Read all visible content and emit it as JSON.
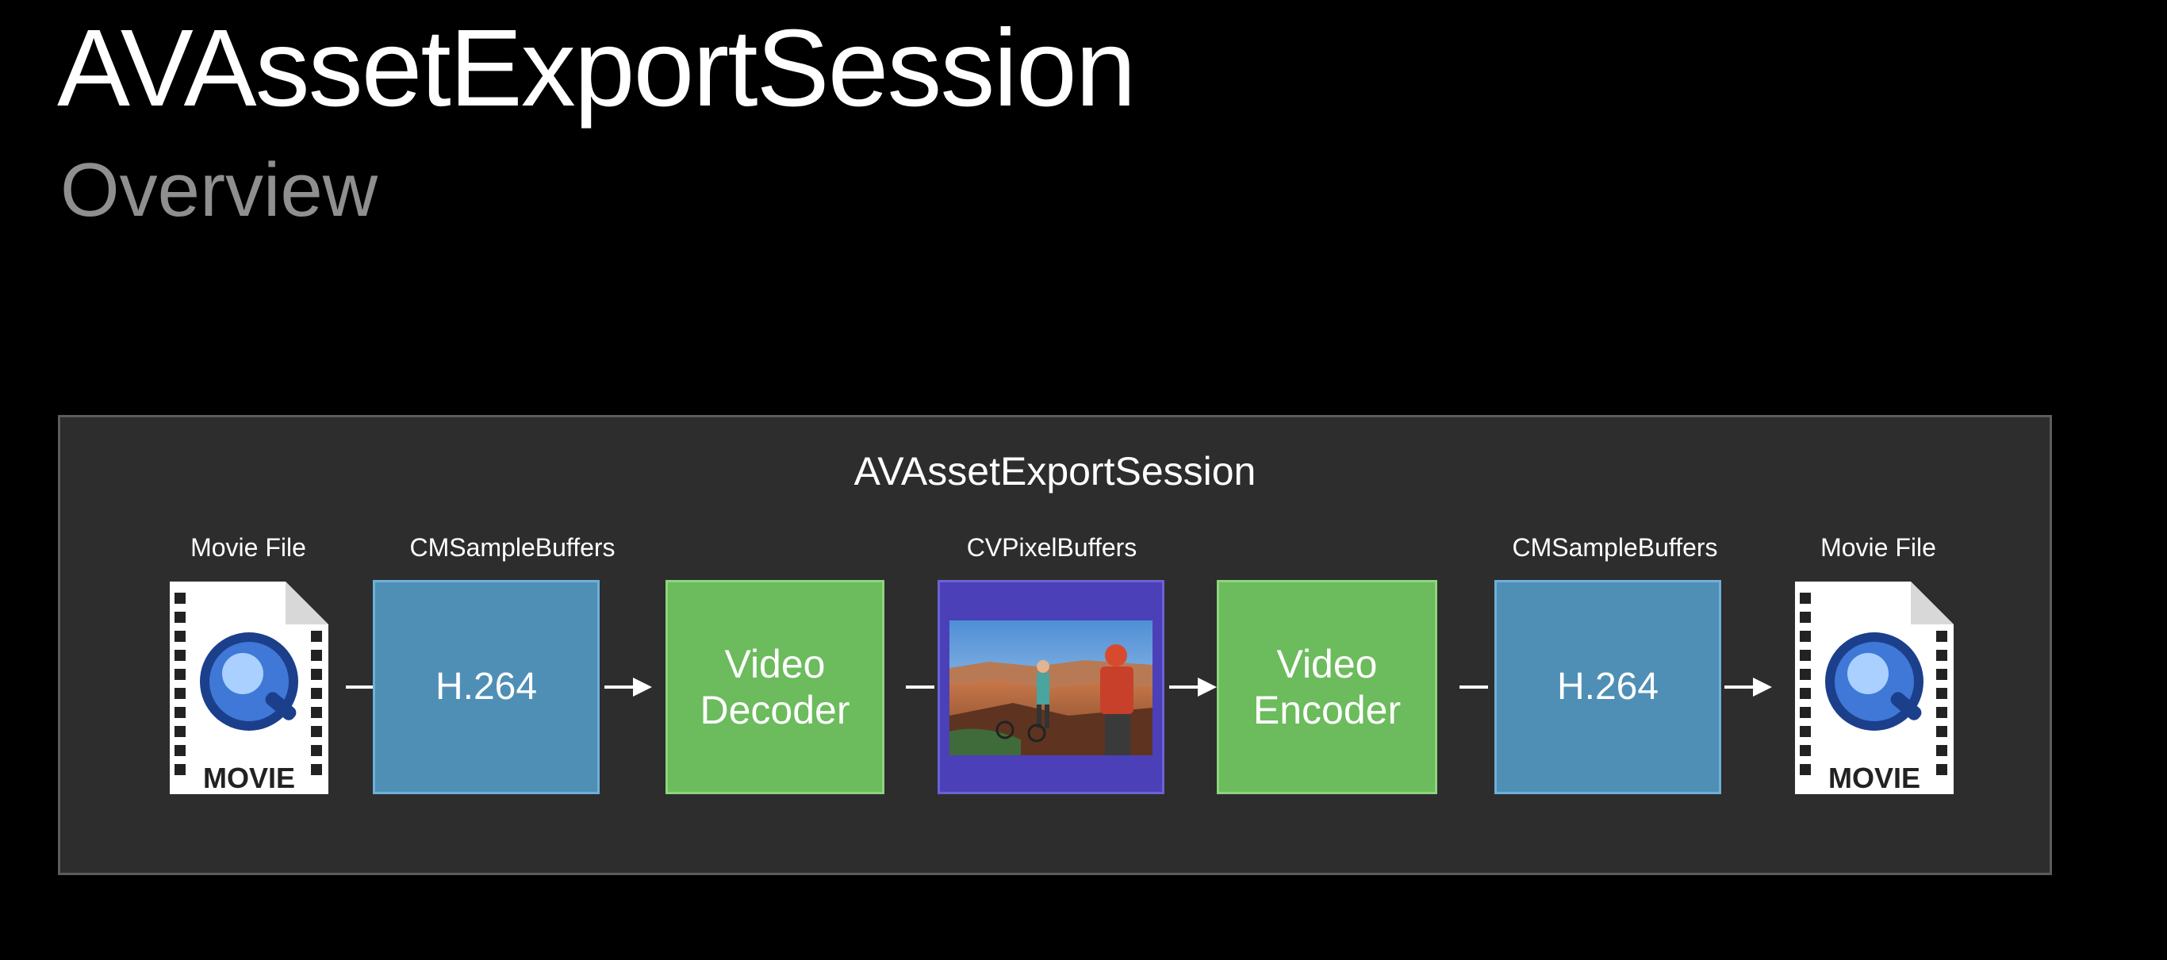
{
  "slide": {
    "title": "AVAssetExportSession",
    "subtitle": "Overview"
  },
  "diagram": {
    "panel_label": "AVAssetExportSession",
    "captions": {
      "input_file": "Movie File",
      "input_buffers": "CMSampleBuffers",
      "pixel_buffers": "CVPixelBuffers",
      "output_buffers": "CMSampleBuffers",
      "output_file": "Movie File"
    },
    "stages": {
      "input_codec": "H.264",
      "decoder_line1": "Video",
      "decoder_line2": "Decoder",
      "encoder_line1": "Video",
      "encoder_line2": "Encoder",
      "output_codec": "H.264"
    },
    "movie_icon_label": "MOVIE",
    "colors": {
      "background": "#000000",
      "panel": "#2d2d2d",
      "sample_buffer_box": "#4f8fb5",
      "codec_box": "#6cbb5d",
      "pixel_buffer_box": "#4b40b8",
      "subtitle": "#8f8f8f"
    },
    "icons": {
      "input_file": "quicktime-movie-file-icon",
      "output_file": "quicktime-movie-file-icon",
      "pixel_buffer": "landscape-photo-thumbnail"
    }
  }
}
